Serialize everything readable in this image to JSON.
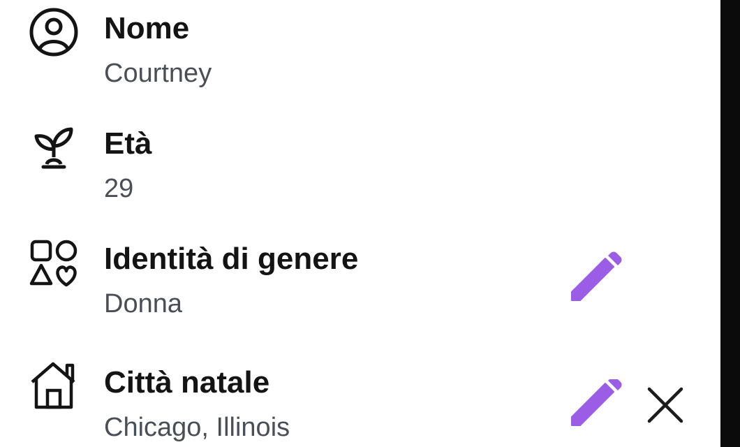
{
  "profile": {
    "fields": [
      {
        "label": "Nome",
        "value": "Courtney",
        "icon": "person-circle-icon"
      },
      {
        "label": "Età",
        "value": "29",
        "icon": "sprout-icon"
      },
      {
        "label": "Identità di genere",
        "value": "Donna",
        "icon": "shapes-icon"
      },
      {
        "label": "Città natale",
        "value": "Chicago, Illinois",
        "icon": "home-icon"
      }
    ]
  },
  "colors": {
    "accent": "#9b5de5",
    "text_primary": "#141414",
    "text_secondary": "#4a4f57"
  }
}
